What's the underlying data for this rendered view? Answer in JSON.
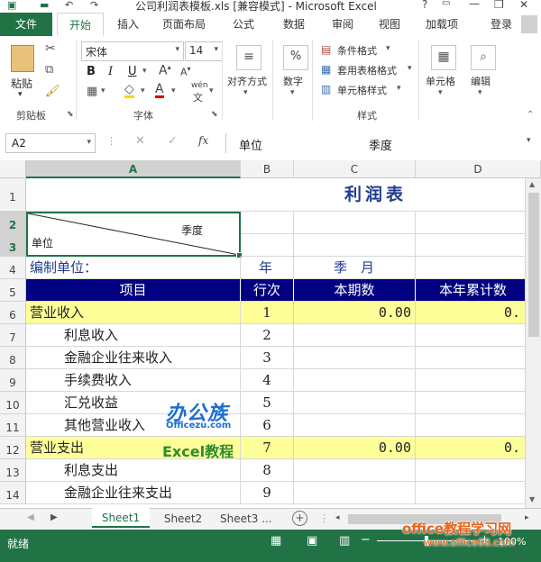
{
  "window": {
    "title": "公司利润表模板.xls  [兼容模式] - Microsoft Excel",
    "help": "?",
    "minimize": "—",
    "restore": "❐",
    "close": "✕"
  },
  "ribbon_tabs": [
    "文件",
    "开始",
    "插入",
    "页面布局",
    "公式",
    "数据",
    "审阅",
    "视图",
    "加载项"
  ],
  "user": "登录",
  "clipboard": {
    "paste": "粘贴",
    "label": "剪贴板"
  },
  "font": {
    "name": "宋体",
    "size": "14",
    "bold": "B",
    "italic": "I",
    "underline": "U",
    "label": "字体",
    "phonetic": "wén"
  },
  "alignment": {
    "label": "对齐方式"
  },
  "number": {
    "label": "数字",
    "percent": "%"
  },
  "styles": {
    "conditional": "条件格式",
    "table": "套用表格格式",
    "cell": "单元格样式",
    "label": "样式"
  },
  "cells": {
    "label": "单元格"
  },
  "editing": {
    "label": "编辑"
  },
  "formula_bar": {
    "name_box": "A2",
    "fx": "fx",
    "content_1": "单位",
    "content_2": "季度"
  },
  "columns": [
    "A",
    "B",
    "C",
    "D"
  ],
  "rows": [
    "1",
    "2",
    "3",
    "4",
    "5",
    "6",
    "7",
    "8",
    "9",
    "10",
    "11",
    "12",
    "13",
    "14"
  ],
  "sheet": {
    "title": "利润表",
    "diag_top": "季度",
    "diag_bottom": "单位",
    "row4": {
      "a": "编制单位：",
      "b": "年",
      "c": "季　月"
    },
    "header": {
      "a": "项目",
      "b": "行次",
      "c": "本期数",
      "d": "本年累计数"
    },
    "r6": {
      "a": "营业收入",
      "b": "1",
      "c": "0.00",
      "d": "0."
    },
    "r7": {
      "a": "利息收入",
      "b": "2"
    },
    "r8": {
      "a": "金融企业往来收入",
      "b": "3"
    },
    "r9": {
      "a": "手续费收入",
      "b": "4"
    },
    "r10": {
      "a": "汇兑收益",
      "b": "5"
    },
    "r11": {
      "a": "其他营业收入",
      "b": "6"
    },
    "r12": {
      "a": "营业支出",
      "b": "7",
      "c": "0.00",
      "d": "0."
    },
    "r13": {
      "a": "利息支出",
      "b": "8"
    },
    "r14": {
      "a": "金融企业往来支出",
      "b": "9"
    }
  },
  "watermark": {
    "logo": "办公族",
    "site": "Officezu.com",
    "text": "Excel教程"
  },
  "sheet_tabs": [
    "Sheet1",
    "Sheet2",
    "Sheet3 ..."
  ],
  "status": {
    "ready": "就绪",
    "zoom": "100%",
    "brand": "office教程学习网",
    "url": "www.office68.com"
  },
  "colors": {
    "accent": "#217346",
    "header_fill": "#000080",
    "highlight": "#ffff99",
    "title": "#1f3d8f"
  }
}
